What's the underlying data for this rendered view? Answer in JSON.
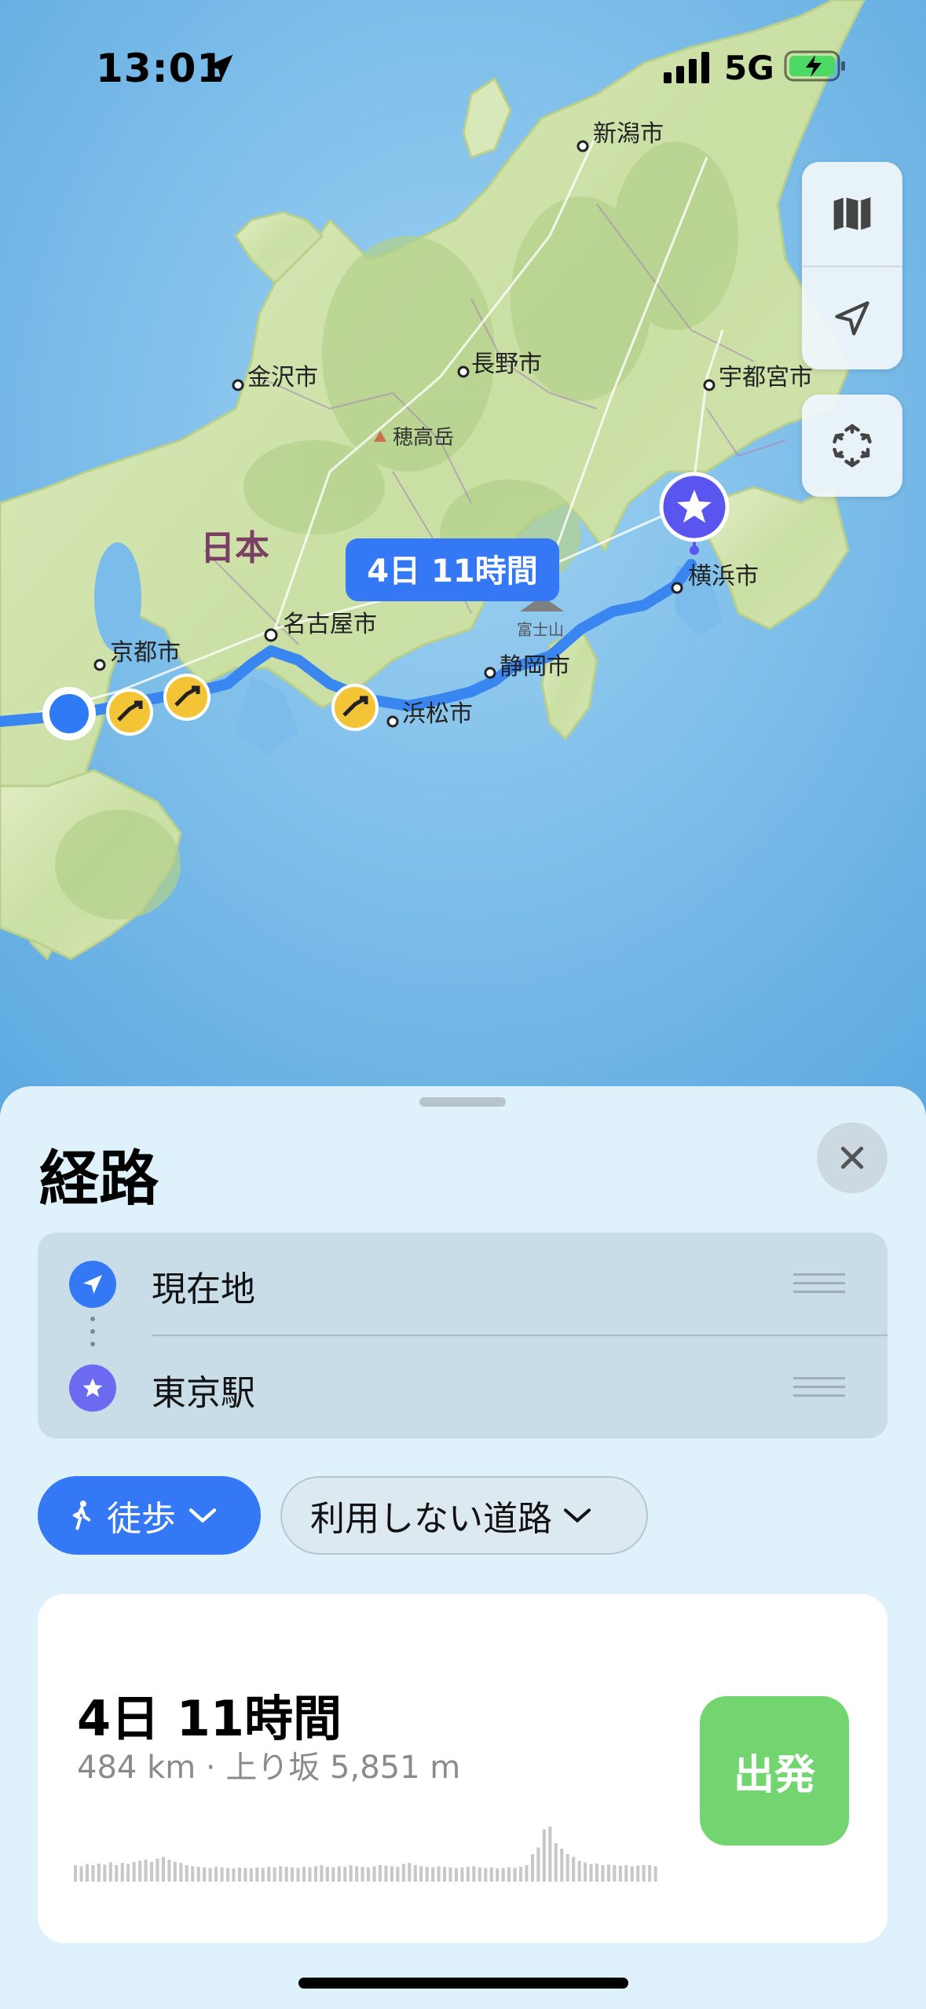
{
  "status_bar": {
    "time": "13:01",
    "network": "5G"
  },
  "map": {
    "route_bubble": "4日 11時間",
    "region_label": "日本",
    "peak_label": "穂高岳",
    "mountain_label": "富士山",
    "cities": {
      "niigata": "新潟市",
      "kanazawa": "金沢市",
      "nagano": "長野市",
      "utsunomiya": "宇都宮市",
      "yokohama": "横浜市",
      "nagoya": "名古屋市",
      "kyoto": "京都市",
      "shizuoka": "静岡市",
      "hamamatsu": "浜松市"
    },
    "colors": {
      "route": "#3a86f0",
      "origin": "#2f7bf5",
      "destination": "#5b55f0",
      "land": "#d9e8b8",
      "sea": "#7cbcea"
    }
  },
  "map_controls": {
    "map_icon": "map-icon",
    "location_icon": "location-arrow-icon",
    "view_icon": "3d-view-icon"
  },
  "sheet": {
    "title": "経路",
    "waypoints": [
      {
        "label": "現在地",
        "icon": "location-arrow-icon"
      },
      {
        "label": "東京駅",
        "icon": "star-icon"
      }
    ],
    "transport_mode": "徒歩",
    "avoid_option": "利用しない道路",
    "route": {
      "duration": "4日 11時間",
      "details": "484 km · 上り坂 5,851 m",
      "go_label": "出発",
      "elevation_profile": [
        0.3,
        0.28,
        0.32,
        0.3,
        0.33,
        0.31,
        0.35,
        0.3,
        0.34,
        0.32,
        0.36,
        0.38,
        0.4,
        0.36,
        0.42,
        0.45,
        0.4,
        0.36,
        0.34,
        0.3,
        0.28,
        0.27,
        0.26,
        0.25,
        0.27,
        0.26,
        0.25,
        0.24,
        0.26,
        0.25,
        0.24,
        0.26,
        0.25,
        0.27,
        0.26,
        0.28,
        0.27,
        0.26,
        0.25,
        0.27,
        0.26,
        0.28,
        0.3,
        0.27,
        0.26,
        0.28,
        0.27,
        0.3,
        0.28,
        0.27,
        0.26,
        0.28,
        0.3,
        0.29,
        0.28,
        0.27,
        0.32,
        0.34,
        0.3,
        0.28,
        0.27,
        0.26,
        0.28,
        0.27,
        0.26,
        0.25,
        0.26,
        0.27,
        0.28,
        0.26,
        0.25,
        0.26,
        0.24,
        0.25,
        0.26,
        0.25,
        0.27,
        0.3,
        0.5,
        0.62,
        0.95,
        1.0,
        0.7,
        0.6,
        0.5,
        0.45,
        0.38,
        0.35,
        0.32,
        0.33,
        0.3,
        0.31,
        0.3,
        0.29,
        0.3,
        0.28,
        0.29,
        0.3,
        0.3,
        0.28
      ]
    }
  }
}
